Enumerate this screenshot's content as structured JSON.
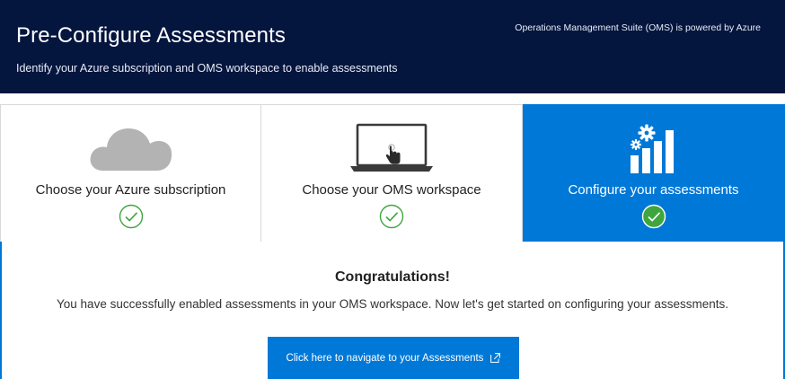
{
  "header": {
    "title": "Pre-Configure Assessments",
    "subtitle": "Identify your Azure subscription and OMS workspace to enable assessments",
    "powered_by": "Operations Management Suite (OMS) is powered by Azure",
    "background_color": "#04153e"
  },
  "steps": [
    {
      "label": "Choose your Azure subscription",
      "icon": "cloud-icon",
      "completed": true,
      "active": false
    },
    {
      "label": "Choose your OMS workspace",
      "icon": "laptop-touch-icon",
      "completed": true,
      "active": false
    },
    {
      "label": "Configure your assessments",
      "icon": "gear-bar-chart-icon",
      "completed": true,
      "active": true
    }
  ],
  "panel": {
    "heading": "Congratulations!",
    "message": "You have successfully enabled assessments in your OMS workspace. Now let's get started on configuring your assessments.",
    "button_label": "Click here to navigate to your Assessments",
    "button_icon": "external-link-icon"
  },
  "colors": {
    "accent": "#0078d7",
    "check_green": "#3fa63f"
  }
}
